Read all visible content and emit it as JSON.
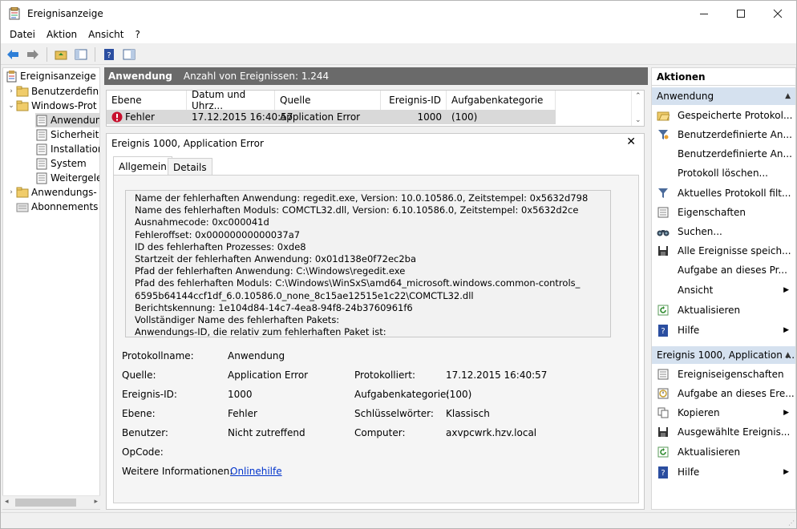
{
  "window": {
    "title": "Ereignisanzeige"
  },
  "menu": [
    "Datei",
    "Aktion",
    "Ansicht",
    "?"
  ],
  "tree": [
    {
      "label": "Ereignisanzeige (L",
      "level": 0,
      "exp": ""
    },
    {
      "label": "Benutzerdefini",
      "level": 1,
      "exp": "›"
    },
    {
      "label": "Windows-Prot",
      "level": 1,
      "exp": "⌄"
    },
    {
      "label": "Anwendun",
      "level": 2,
      "exp": ""
    },
    {
      "label": "Sicherheit",
      "level": 2,
      "exp": ""
    },
    {
      "label": "Installation",
      "level": 2,
      "exp": ""
    },
    {
      "label": "System",
      "level": 2,
      "exp": ""
    },
    {
      "label": "Weitergele",
      "level": 2,
      "exp": ""
    },
    {
      "label": "Anwendungs-",
      "level": 1,
      "exp": "›"
    },
    {
      "label": "Abonnements",
      "level": 1,
      "exp": ""
    }
  ],
  "header": {
    "log": "Anwendung",
    "count": "Anzahl von Ereignissen: 1.244"
  },
  "grid": {
    "columns": [
      "Ebene",
      "Datum und Uhrz...",
      "Quelle",
      "Ereignis-ID",
      "Aufgabenkategorie"
    ],
    "row": {
      "level": "Fehler",
      "date": "17.12.2015 16:40:57",
      "source": "Application Error",
      "id": "1000",
      "category": "(100)"
    }
  },
  "detail": {
    "title": "Ereignis 1000, Application Error",
    "tabs": [
      "Allgemein",
      "Details"
    ],
    "message_lines": [
      "Name der fehlerhaften Anwendung: regedit.exe, Version: 10.0.10586.0, Zeitstempel: 0x5632d798",
      "Name des fehlerhaften Moduls: COMCTL32.dll, Version: 6.10.10586.0, Zeitstempel: 0x5632d2ce",
      "Ausnahmecode: 0xc000041d",
      "Fehleroffset: 0x00000000000037a7",
      "ID des fehlerhaften Prozesses: 0xde8",
      "Startzeit der fehlerhaften Anwendung: 0x01d138e0f72ec2ba",
      "Pfad der fehlerhaften Anwendung: C:\\Windows\\regedit.exe",
      "Pfad des fehlerhaften Moduls: C:\\Windows\\WinSxS\\amd64_microsoft.windows.common-controls_",
      "6595b64144ccf1df_6.0.10586.0_none_8c15ae12515e1c22\\COMCTL32.dll",
      "Berichtskennung: 1e104d84-14c7-4ea8-94f8-24b3760961f6",
      "Vollständiger Name des fehlerhaften Pakets:",
      "Anwendungs-ID, die relativ zum fehlerhaften Paket ist:"
    ],
    "fields": {
      "protokollname_label": "Protokollname:",
      "protokollname": "Anwendung",
      "quelle_label": "Quelle:",
      "quelle": "Application Error",
      "protokolliert_label": "Protokolliert:",
      "protokolliert": "17.12.2015 16:40:57",
      "ereignisid_label": "Ereignis-ID:",
      "ereignisid": "1000",
      "aufgabe_label": "Aufgabenkategorie:",
      "aufgabe": "(100)",
      "ebene_label": "Ebene:",
      "ebene": "Fehler",
      "schluessel_label": "Schlüsselwörter:",
      "schluessel": "Klassisch",
      "benutzer_label": "Benutzer:",
      "benutzer": "Nicht zutreffend",
      "computer_label": "Computer:",
      "computer": "axvpcwrk.hzv.local",
      "opcode_label": "OpCode:",
      "weitere_label": "Weitere Informationen:",
      "weitere_link": "Onlinehilfe"
    }
  },
  "actions": {
    "title": "Aktionen",
    "section1": "Anwendung",
    "items1": [
      {
        "label": "Gespeicherte Protokol...",
        "icon": "folder-open-icon"
      },
      {
        "label": "Benutzerdefinierte An...",
        "icon": "filter-icon"
      },
      {
        "label": "Benutzerdefinierte An...",
        "icon": ""
      },
      {
        "label": "Protokoll löschen...",
        "icon": ""
      },
      {
        "label": "Aktuelles Protokoll filt...",
        "icon": "filter-icon"
      },
      {
        "label": "Eigenschaften",
        "icon": "properties-icon"
      },
      {
        "label": "Suchen...",
        "icon": "binoculars-icon"
      },
      {
        "label": "Alle Ereignisse speich...",
        "icon": "save-icon"
      },
      {
        "label": "Aufgabe an dieses Pr...",
        "icon": ""
      },
      {
        "label": "Ansicht",
        "icon": "",
        "submenu": true
      },
      {
        "label": "Aktualisieren",
        "icon": "refresh-icon"
      },
      {
        "label": "Hilfe",
        "icon": "help-icon",
        "submenu": true
      }
    ],
    "section2": "Ereignis 1000, Application ...",
    "items2": [
      {
        "label": "Ereigniseigenschaften",
        "icon": "properties-icon"
      },
      {
        "label": "Aufgabe an dieses Ere...",
        "icon": "task-icon"
      },
      {
        "label": "Kopieren",
        "icon": "copy-icon",
        "submenu": true
      },
      {
        "label": "Ausgewählte Ereignis...",
        "icon": "save-icon"
      },
      {
        "label": "Aktualisieren",
        "icon": "refresh-icon"
      },
      {
        "label": "Hilfe",
        "icon": "help-icon",
        "submenu": true
      }
    ]
  }
}
